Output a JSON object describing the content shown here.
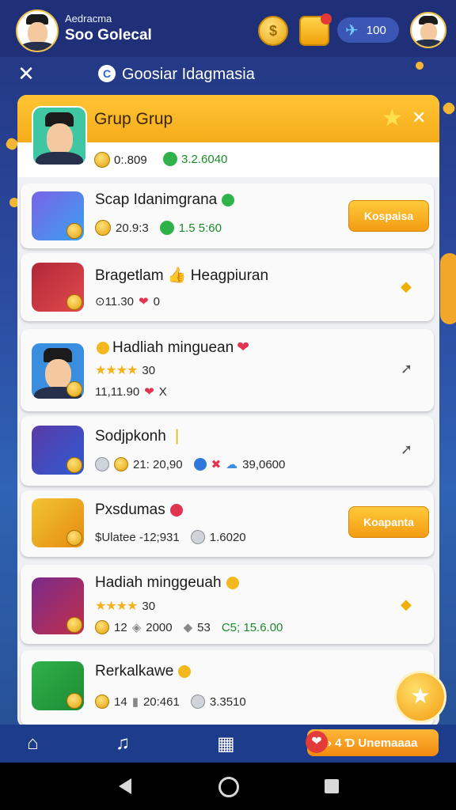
{
  "topbar": {
    "user_sub": "Aedracma",
    "user_name": "Soo Golecal",
    "coin_symbol": "$",
    "ticket_value": "100"
  },
  "title": {
    "close": "✕",
    "text": "Goosiar Idagmasia"
  },
  "group": {
    "title": "Grup Grup",
    "stat1": "0:.809",
    "stat2": "3.2.6040",
    "close": "✕"
  },
  "rows": [
    {
      "title": "Scap Idanimgrana",
      "sub1": "20.9:3",
      "sub2": "1.5 5:60",
      "button": "Kospaisa"
    },
    {
      "title": "Bragetlam 👍 Heagpiuran",
      "sub1": "⊙11.30",
      "sub2": "0"
    },
    {
      "title": "Hadliah minguean",
      "stars": "★★★★",
      "rating": "30",
      "sub": "11,11.90",
      "sub_end": "X"
    },
    {
      "title": "Sodjpkonh",
      "sub1": "21: 20,90",
      "sub2": "39,0600"
    },
    {
      "title": "Pxsdumas",
      "sub1": "$Ulatee -12;931",
      "sub2": "1.6020",
      "button": "Koapanta"
    },
    {
      "title": "Hadiah minggeuah",
      "stars": "★★★★",
      "rating": "30",
      "sub1": "12",
      "sub2": "2000",
      "sub3": "53",
      "sub4": "C5; 15.6.00"
    },
    {
      "title": "Rerkalkawe",
      "sub1": "14",
      "sub2": "20:461",
      "sub3": "3.3510"
    }
  ],
  "nav": {
    "pill_label": "› 4 Ɗ Unemaaaa"
  },
  "colors": {
    "accent": "#f5ac1a",
    "background": "#2b4aa0",
    "nav": "#1e3c8c"
  }
}
